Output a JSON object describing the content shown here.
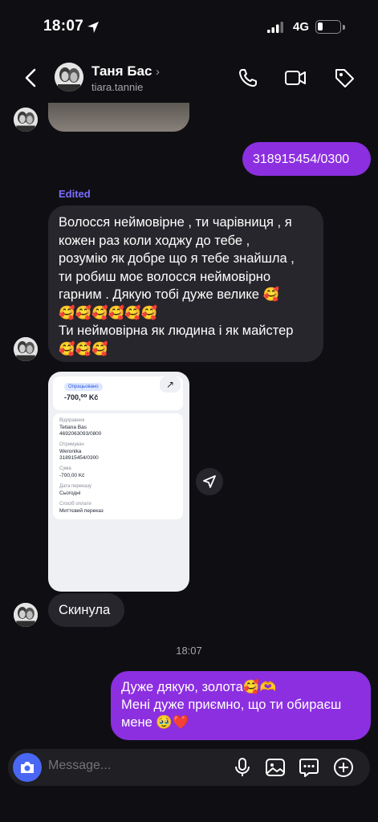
{
  "status": {
    "time": "18:07",
    "network": "4G"
  },
  "header": {
    "name": "Таня Бас",
    "chevron": "›",
    "username": "tiara.tannie"
  },
  "messages": {
    "account_out": "318915454/0300",
    "edited_label": "Edited",
    "long_in": {
      "line1": "Волосся неймовірне , ти чарівниця , я",
      "line2": "кожен раз коли ходжу до тебе ,",
      "line3": "розумію як добре що я тебе знайшла ,",
      "line4": "ти робиш моє волосся неймовірно",
      "line5": "гарним . Дякую тобі дуже велике 🥰",
      "line6": "🥰🥰🥰🥰🥰🥰",
      "line7": "Ти неймовірна як людина і як майстер",
      "line8": "🥰🥰🥰"
    },
    "sent_in": "Скинула",
    "timestamp": "18:07",
    "thanks_out": {
      "line1": "Дуже дякую, золота🥰🫶",
      "line2": "Мені дуже приємно, що ти обираєш",
      "line3": "мене 🥹❤️"
    }
  },
  "receipt": {
    "badge": "Опрацьовано",
    "amount": "-700,⁰⁰ Kč",
    "sender_label": "Відправник",
    "sender_name": "Tetiana Bas",
    "sender_account": "4692063093/0800",
    "recipient_label": "Отримувач",
    "recipient_name": "Weronika",
    "recipient_account": "318915454/0300",
    "sum_label": "Сума",
    "sum_value": "-700,00 Kč",
    "date_label": "Дата переказу",
    "date_value": "Сьогодні",
    "method_label": "Спосіб оплати",
    "method_value": "Миттєвий переказ"
  },
  "composer": {
    "placeholder": "Message..."
  },
  "icons": {
    "location": "location-arrow-icon",
    "signal": "signal-icon",
    "battery": "battery-icon",
    "back": "chevron-left-icon",
    "call": "phone-icon",
    "video": "video-camera-icon",
    "tag": "tag-icon",
    "share": "send-icon",
    "camera": "camera-icon",
    "mic": "microphone-icon",
    "gallery": "image-icon",
    "sticker": "chat-sticker-icon",
    "plus": "plus-circle-icon"
  },
  "colors": {
    "outgoing_bubble": "#8c2fe0",
    "incoming_bubble": "#26262c",
    "edited_label": "#7b6cff",
    "background": "#0f0f13",
    "camera_button": "#4a67f4"
  }
}
